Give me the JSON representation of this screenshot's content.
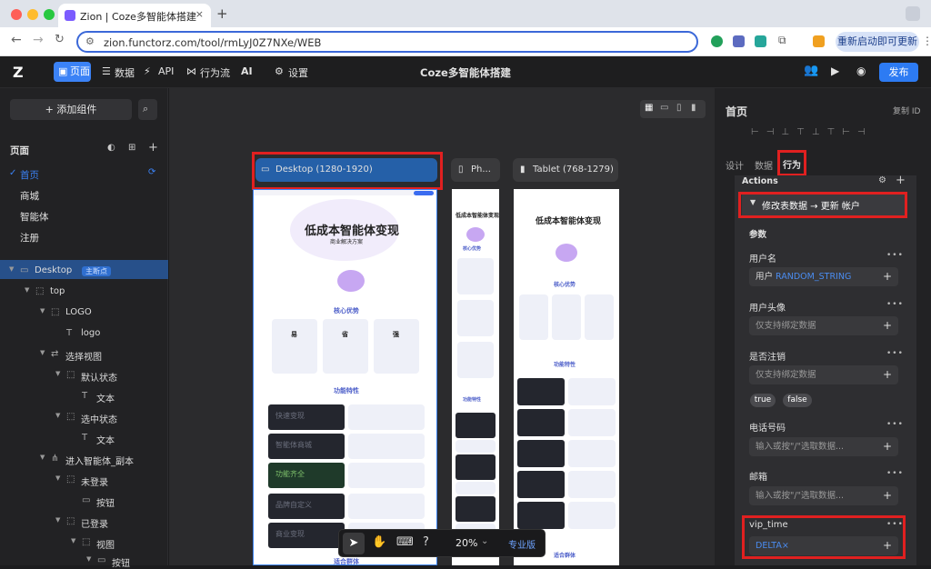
{
  "browser": {
    "tab_title": "Zion | Coze多智能体搭建",
    "url": "zion.functorz.com/tool/rmLyJ0Z7NXe/WEB",
    "restart_label": "重新启动即可更新"
  },
  "topnav": {
    "items": [
      "页面",
      "数据",
      "API",
      "行为流",
      "AI",
      "设置"
    ],
    "project_title": "Coze多智能体搭建",
    "publish_label": "发布"
  },
  "sidebar": {
    "add_component_label": "添加组件",
    "pages_title": "页面",
    "pages": [
      "首页",
      "商城",
      "智能体",
      "注册"
    ],
    "tree": [
      {
        "label": "Desktop",
        "badge": "主断点",
        "depth": 0
      },
      {
        "label": "top",
        "depth": 1
      },
      {
        "label": "LOGO",
        "depth": 2
      },
      {
        "label": "logo",
        "depth": 3
      },
      {
        "label": "选择视图",
        "depth": 2
      },
      {
        "label": "默认状态",
        "depth": 3
      },
      {
        "label": "文本",
        "depth": 4
      },
      {
        "label": "选中状态",
        "depth": 3
      },
      {
        "label": "文本",
        "depth": 4
      },
      {
        "label": "进入智能体_副本",
        "depth": 2
      },
      {
        "label": "未登录",
        "depth": 3
      },
      {
        "label": "按钮",
        "depth": 4
      },
      {
        "label": "已登录",
        "depth": 3
      },
      {
        "label": "视图",
        "depth": 4
      },
      {
        "label": "按钮",
        "depth": 5
      }
    ]
  },
  "canvas": {
    "frames": [
      {
        "label": "Desktop (1280-1920)"
      },
      {
        "label": "Ph..."
      },
      {
        "label": "Tablet (768-1279)"
      }
    ],
    "preview": {
      "hero_title": "低成本智能体变现",
      "hero_subtitle": "商业解决方案",
      "section_core": "核心优势",
      "core_items": [
        "易",
        "省",
        "强"
      ],
      "section_features": "功能特性",
      "section_audience": "适合群体",
      "banner_texts": [
        "快速变现",
        "智能体商城",
        "功能齐全",
        "品牌自定义",
        "商业变现"
      ]
    },
    "zoom": "20%",
    "pro_label": "专业版"
  },
  "rightpanel": {
    "title": "首页",
    "copy_id": "复制 ID",
    "tabs": [
      "设计",
      "数据",
      "行为"
    ],
    "actions_label": "Actions",
    "action_item": "修改表数据 → 更新 帐户",
    "params_label": "参数",
    "params": [
      {
        "label": "用户名",
        "prefix": "用户",
        "value": "RANDOM_STRING"
      },
      {
        "label": "用户头像",
        "value": "仅支持绑定数据"
      },
      {
        "label": "是否注销",
        "value": "仅支持绑定数据"
      },
      {
        "label": "电话号码",
        "value": "输入或按\"/\"选取数据..."
      },
      {
        "label": "邮箱",
        "value": "输入或按\"/\"选取数据..."
      },
      {
        "label": "vip_time",
        "value": "DELTA×"
      }
    ],
    "bool_options": [
      "true",
      "false"
    ]
  },
  "colors": {
    "accent": "#3b82f6",
    "highlight": "#e02020",
    "selected_row": "#27508a"
  }
}
